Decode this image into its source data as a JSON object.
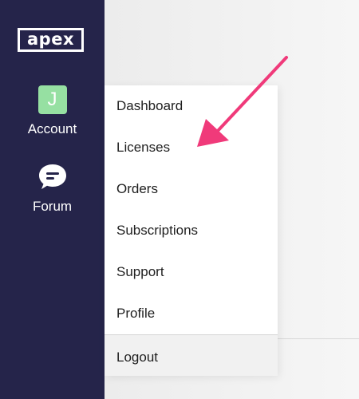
{
  "sidebar": {
    "logo_text": "apex",
    "account": {
      "avatar_letter": "J",
      "label": "Account"
    },
    "forum": {
      "label": "Forum"
    }
  },
  "dropdown": {
    "items": [
      {
        "label": "Dashboard"
      },
      {
        "label": "Licenses"
      },
      {
        "label": "Orders"
      },
      {
        "label": "Subscriptions"
      },
      {
        "label": "Support"
      },
      {
        "label": "Profile"
      }
    ],
    "logout_label": "Logout"
  },
  "colors": {
    "sidebar_bg": "#25244a",
    "avatar_bg": "#96e0a2",
    "arrow": "#f03a7a"
  }
}
